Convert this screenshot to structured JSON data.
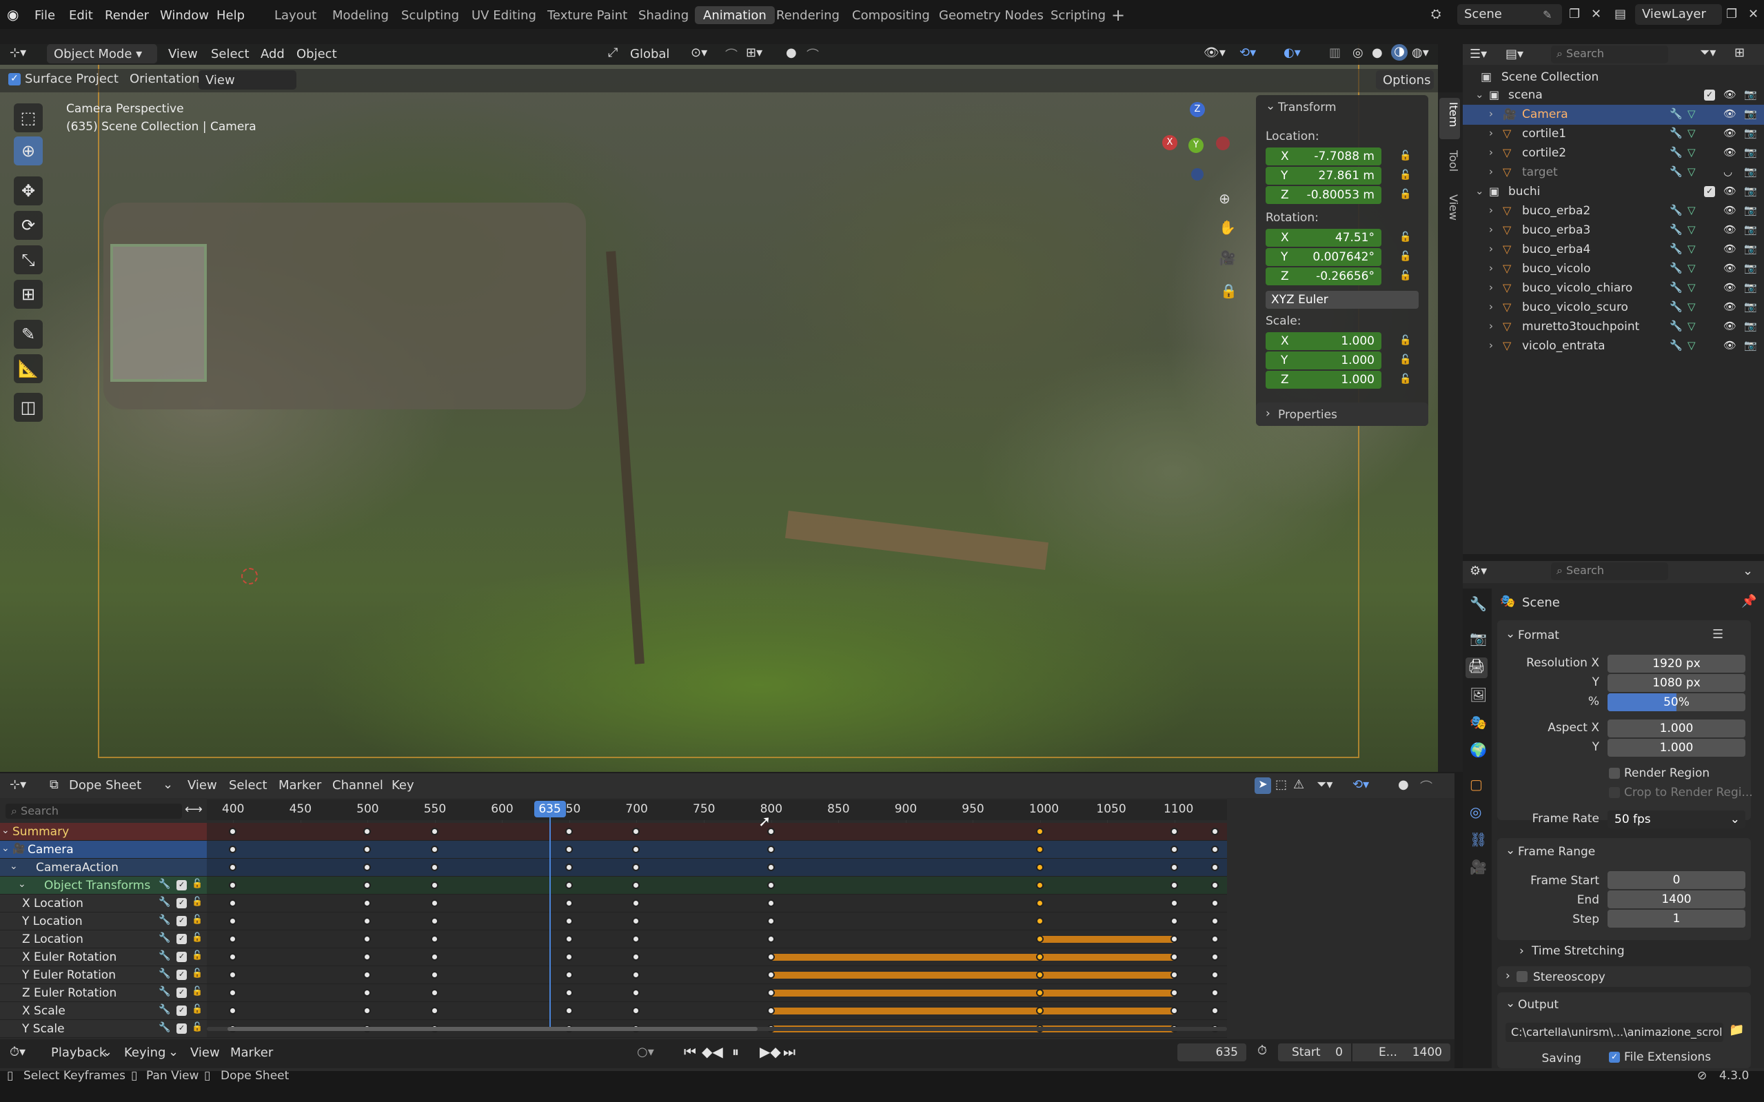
{
  "app": {
    "version": "4.3.0"
  },
  "menubar": {
    "items": [
      "File",
      "Edit",
      "Render",
      "Window",
      "Help"
    ]
  },
  "workspaces": {
    "tabs": [
      "Layout",
      "Modeling",
      "Sculpting",
      "UV Editing",
      "Texture Paint",
      "Shading",
      "Animation",
      "Rendering",
      "Compositing",
      "Geometry Nodes",
      "Scripting"
    ],
    "active": "Animation"
  },
  "scene": {
    "name": "Scene",
    "view_layer": "ViewLayer"
  },
  "viewport": {
    "mode": "Object Mode",
    "menus": [
      "View",
      "Select",
      "Add",
      "Object"
    ],
    "transform_orientation": "Global",
    "surface_project_label": "Surface Project",
    "orientation_label": "Orientation:",
    "orientation_value": "View",
    "options_label": "Options",
    "overlay_title": "Camera Perspective",
    "overlay_subtitle": "(635) Scene Collection | Camera"
  },
  "npanel": {
    "tabs": [
      "Item",
      "Tool",
      "View"
    ],
    "transform_title": "Transform",
    "location_label": "Location:",
    "location": {
      "x": "-7.7088 m",
      "y": "27.861 m",
      "z": "-0.80053 m"
    },
    "rotation_label": "Rotation:",
    "rotation": {
      "x": "47.51°",
      "y": "0.007642°",
      "z": "-0.26656°"
    },
    "rotation_mode": "XYZ Euler",
    "scale_label": "Scale:",
    "scale": {
      "x": "1.000",
      "y": "1.000",
      "z": "1.000"
    },
    "axis": {
      "x": "X",
      "y": "Y",
      "z": "Z"
    },
    "properties_title": "Properties"
  },
  "outliner": {
    "search_placeholder": "Search",
    "root": "Scene Collection",
    "rows": [
      {
        "label": "scena",
        "kind": "collection"
      },
      {
        "label": "Camera",
        "kind": "camera",
        "selected": true
      },
      {
        "label": "cortile1",
        "kind": "mesh"
      },
      {
        "label": "cortile2",
        "kind": "mesh"
      },
      {
        "label": "target",
        "kind": "mesh",
        "dimmed": true
      },
      {
        "label": "buchi",
        "kind": "collection"
      },
      {
        "label": "buco_erba2",
        "kind": "mesh"
      },
      {
        "label": "buco_erba3",
        "kind": "mesh"
      },
      {
        "label": "buco_erba4",
        "kind": "mesh"
      },
      {
        "label": "buco_vicolo",
        "kind": "mesh"
      },
      {
        "label": "buco_vicolo_chiaro",
        "kind": "mesh"
      },
      {
        "label": "buco_vicolo_scuro",
        "kind": "mesh"
      },
      {
        "label": "muretto3touchpoint",
        "kind": "mesh"
      },
      {
        "label": "vicolo_entrata",
        "kind": "mesh"
      }
    ]
  },
  "properties": {
    "search_placeholder": "Search",
    "context": "Scene",
    "format_title": "Format",
    "resolution_x_label": "Resolution X",
    "resolution_x": "1920 px",
    "resolution_y_label": "Y",
    "resolution_y": "1080 px",
    "percent_label": "%",
    "percent": "50%",
    "percent_fraction": 0.5,
    "aspect_x_label": "Aspect X",
    "aspect_x": "1.000",
    "aspect_y_label": "Y",
    "aspect_y": "1.000",
    "render_region_label": "Render Region",
    "crop_label": "Crop to Render Regi...",
    "frame_rate_label": "Frame Rate",
    "frame_rate": "50 fps",
    "frame_range_title": "Frame Range",
    "frame_start_label": "Frame Start",
    "frame_start": "0",
    "end_label": "End",
    "end": "1400",
    "step_label": "Step",
    "step": "1",
    "time_stretching_title": "Time Stretching",
    "stereoscopy_title": "Stereoscopy",
    "output_title": "Output",
    "output_path": "C:\\cartella\\unirsm\\...\\animazione_scroll",
    "saving_label": "Saving",
    "file_extensions_label": "File Extensions"
  },
  "dopesheet": {
    "mode": "Dope Sheet",
    "menus": [
      "View",
      "Select",
      "Marker",
      "Channel",
      "Key"
    ],
    "search_placeholder": "Search",
    "current_frame": "635",
    "ticks": [
      "400",
      "450",
      "500",
      "550",
      "600",
      "650",
      "700",
      "750",
      "800",
      "850",
      "900",
      "950",
      "1000",
      "1050",
      "1100"
    ],
    "tick_values": [
      400,
      450,
      500,
      550,
      600,
      650,
      700,
      750,
      800,
      850,
      900,
      950,
      1000,
      1050,
      1100
    ],
    "channels": [
      "Summary",
      "Camera",
      "CameraAction",
      "Object Transforms",
      "X Location",
      "Y Location",
      "Z Location",
      "X Euler Rotation",
      "Y Euler Rotation",
      "Z Euler Rotation",
      "X Scale",
      "Y Scale"
    ],
    "keyframes": [
      400,
      500,
      550,
      650,
      700,
      800,
      1000,
      1100,
      1130
    ],
    "selected_keyframe": 1000,
    "holds": {
      "Z Location": [
        1000,
        1100
      ],
      "X Euler Rotation": [
        800,
        1100
      ],
      "Y Euler Rotation": [
        800,
        1100
      ],
      "Z Euler Rotation": [
        800,
        1100
      ],
      "X Scale": [
        800,
        1100
      ],
      "Y Scale": [
        800,
        1100
      ]
    }
  },
  "timeline": {
    "menus": [
      "Playback",
      "Keying",
      "View",
      "Marker"
    ],
    "current_frame": "635",
    "start_label": "Start",
    "start": "0",
    "end_label": "E...",
    "end": "1400"
  },
  "statusbar": {
    "items": [
      "Select Keyframes",
      "Pan View",
      "Dope Sheet"
    ],
    "version": "4.3.0"
  },
  "colors": {
    "accent": "#4a6fa3",
    "keyframe_selected": "#ffb21a",
    "hold": "#c97b16",
    "vector_field": "#3a7a2a"
  }
}
